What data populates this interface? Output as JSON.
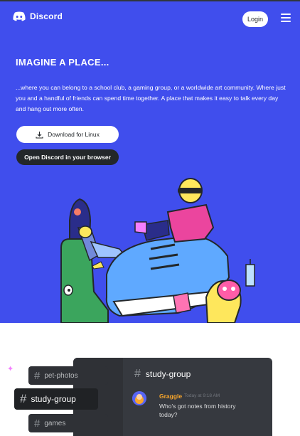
{
  "nav": {
    "brand": "Discord",
    "login_label": "Login",
    "menu_icon": "hamburger-icon"
  },
  "hero": {
    "headline": "IMAGINE A PLACE...",
    "subtext": "...where you can belong to a school club, a gaming group, or a worldwide art community. Where just you and a handful of friends can spend time together. A place that makes it easy to talk every day and hang out more often.",
    "download_label": "Download for Linux",
    "browser_label": "Open Discord in your browser",
    "illustration": "characters-on-giant-sneaker-illustration"
  },
  "feature": {
    "channels": [
      {
        "hash": "#",
        "label": "pet-photos"
      },
      {
        "hash": "#",
        "label": "study-group"
      },
      {
        "hash": "#",
        "label": "games"
      }
    ],
    "channel_header": {
      "hash": "#",
      "label": "study-group"
    },
    "message": {
      "author": "Graggle",
      "time": "Today at 9:18 AM",
      "text": "Who's got notes from history today?"
    }
  },
  "colors": {
    "blurple": "#404eed",
    "dark": "#23272a",
    "panel": "#36393f",
    "author": "#f9a62b"
  }
}
